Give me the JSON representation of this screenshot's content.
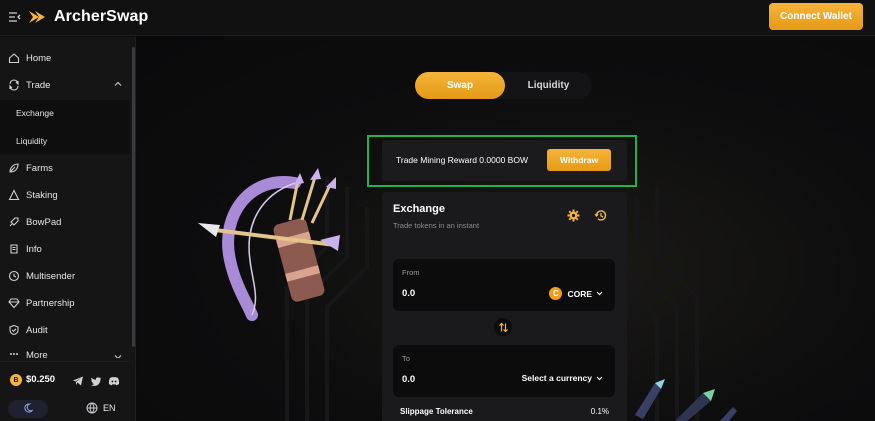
{
  "header": {
    "brand": "ArcherSwap",
    "connect_wallet": "Connect Wallet"
  },
  "sidebar": {
    "items": [
      {
        "label": "Home",
        "icon": "home-icon"
      },
      {
        "label": "Trade",
        "icon": "trade-icon",
        "expanded": true
      },
      {
        "label": "Farms",
        "icon": "farms-icon"
      },
      {
        "label": "Staking",
        "icon": "staking-icon"
      },
      {
        "label": "BowPad",
        "icon": "bowpad-icon"
      },
      {
        "label": "Info",
        "icon": "info-icon"
      },
      {
        "label": "Multisender",
        "icon": "multisender-icon"
      },
      {
        "label": "Partnership",
        "icon": "partnership-icon"
      },
      {
        "label": "Audit",
        "icon": "audit-icon"
      },
      {
        "label": "More",
        "icon": "more-icon"
      }
    ],
    "trade_sub": [
      "Exchange",
      "Liquidity"
    ],
    "price": "$0.250",
    "lang": "EN"
  },
  "tabs": {
    "swap": "Swap",
    "liquidity": "Liquidity",
    "active": "Swap"
  },
  "reward": {
    "text": "Trade Mining Reward 0.0000 BOW",
    "withdraw": "Withdraw"
  },
  "exchange": {
    "title": "Exchange",
    "subtitle": "Trade tokens in an instant",
    "from": {
      "label": "From",
      "value": "0.0",
      "token": "CORE"
    },
    "to": {
      "label": "To",
      "value": "0.0",
      "token": "Select a currency"
    },
    "slippage_label": "Slippage Tolerance",
    "slippage_value": "0.1%"
  },
  "colors": {
    "accent": "#f5b53a",
    "highlight": "#22b14c",
    "core": "#f59b1a"
  }
}
